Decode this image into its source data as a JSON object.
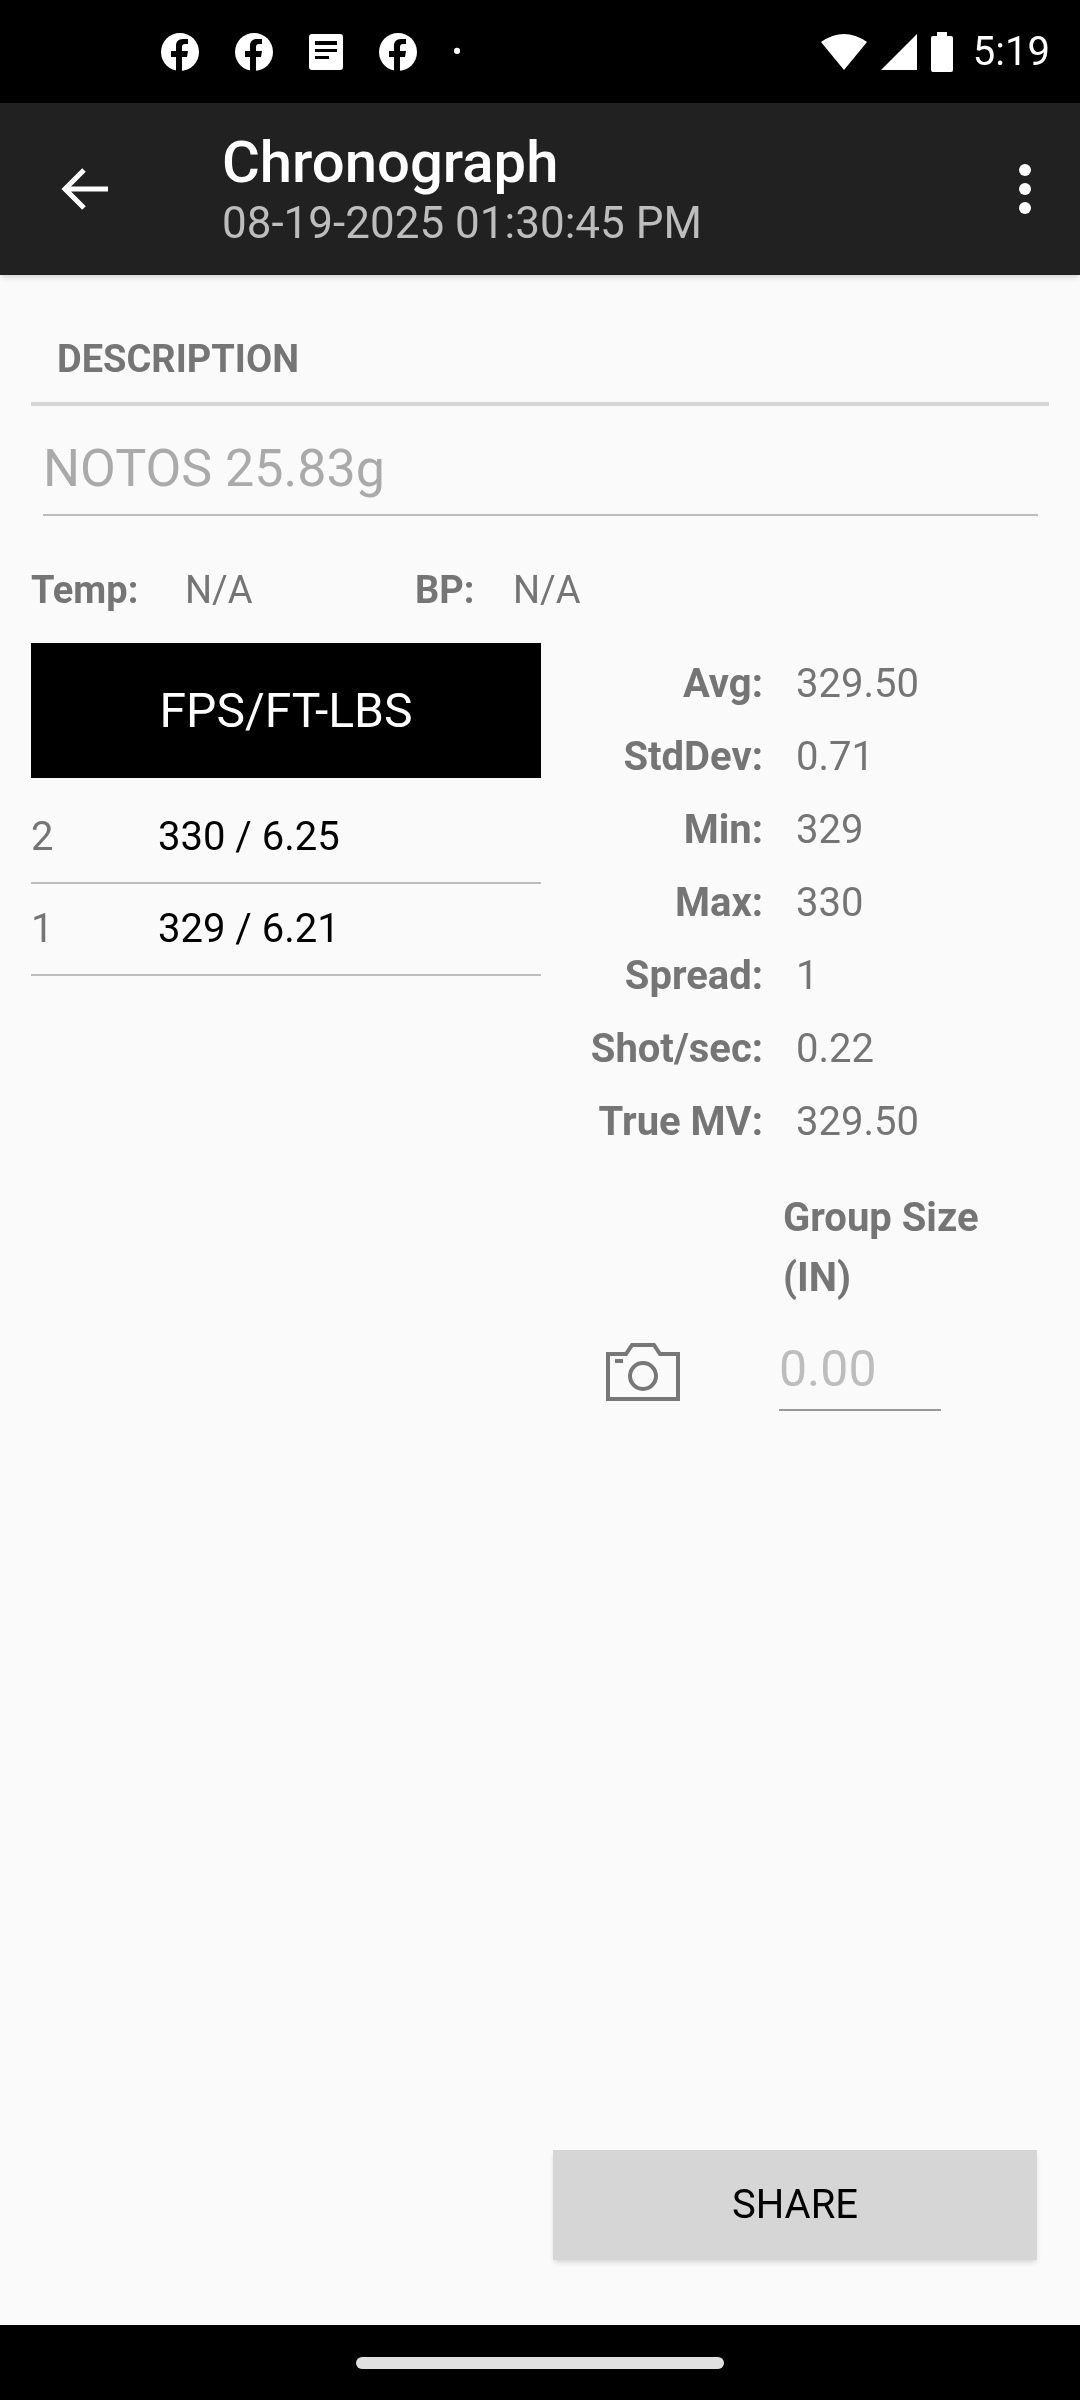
{
  "status_bar": {
    "time": "5:19",
    "notification_dot": "•"
  },
  "app_bar": {
    "title": "Chronograph",
    "subtitle": "08-19-2025 01:30:45 PM"
  },
  "description": {
    "heading": "DESCRIPTION",
    "value": "NOTOS 25.83g"
  },
  "conditions": [
    {
      "label": "Temp:",
      "value": "N/A"
    },
    {
      "label": "BP:",
      "value": "N/A"
    }
  ],
  "shots": {
    "header": "FPS/FT-LBS",
    "rows": [
      {
        "number": "2",
        "value": "330 / 6.25"
      },
      {
        "number": "1",
        "value": "329 / 6.21"
      }
    ]
  },
  "stats": [
    {
      "label": "Avg:",
      "value": "329.50"
    },
    {
      "label": "StdDev:",
      "value": "0.71"
    },
    {
      "label": "Min:",
      "value": "329"
    },
    {
      "label": "Max:",
      "value": "330"
    },
    {
      "label": "Spread:",
      "value": "1"
    },
    {
      "label": "Shot/sec:",
      "value": "0.22"
    },
    {
      "label": "True MV:",
      "value": "329.50"
    }
  ],
  "group_size": {
    "label": "Group Size (IN)",
    "placeholder": "0.00"
  },
  "share_button": "SHARE"
}
